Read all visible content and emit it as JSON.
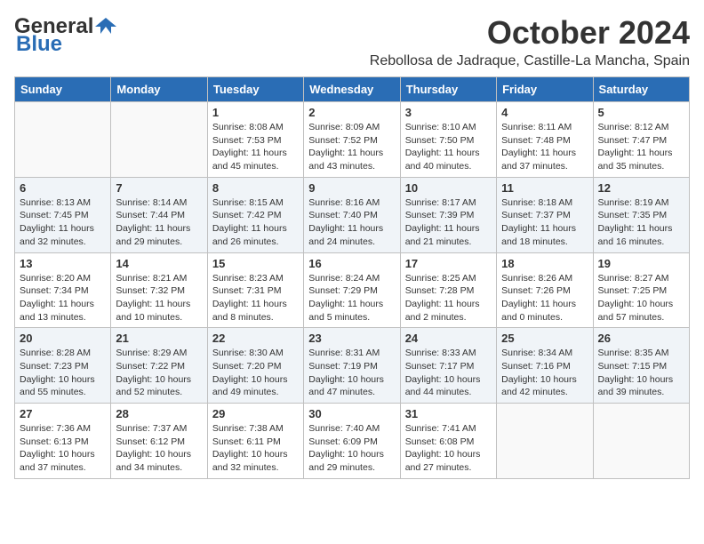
{
  "logo": {
    "line1": "General",
    "line2": "Blue"
  },
  "title": "October 2024",
  "subtitle": "Rebollosa de Jadraque, Castille-La Mancha, Spain",
  "weekdays": [
    "Sunday",
    "Monday",
    "Tuesday",
    "Wednesday",
    "Thursday",
    "Friday",
    "Saturday"
  ],
  "weeks": [
    {
      "shaded": false,
      "days": [
        {
          "date": "",
          "text": ""
        },
        {
          "date": "",
          "text": ""
        },
        {
          "date": "1",
          "text": "Sunrise: 8:08 AM\nSunset: 7:53 PM\nDaylight: 11 hours and 45 minutes."
        },
        {
          "date": "2",
          "text": "Sunrise: 8:09 AM\nSunset: 7:52 PM\nDaylight: 11 hours and 43 minutes."
        },
        {
          "date": "3",
          "text": "Sunrise: 8:10 AM\nSunset: 7:50 PM\nDaylight: 11 hours and 40 minutes."
        },
        {
          "date": "4",
          "text": "Sunrise: 8:11 AM\nSunset: 7:48 PM\nDaylight: 11 hours and 37 minutes."
        },
        {
          "date": "5",
          "text": "Sunrise: 8:12 AM\nSunset: 7:47 PM\nDaylight: 11 hours and 35 minutes."
        }
      ]
    },
    {
      "shaded": true,
      "days": [
        {
          "date": "6",
          "text": "Sunrise: 8:13 AM\nSunset: 7:45 PM\nDaylight: 11 hours and 32 minutes."
        },
        {
          "date": "7",
          "text": "Sunrise: 8:14 AM\nSunset: 7:44 PM\nDaylight: 11 hours and 29 minutes."
        },
        {
          "date": "8",
          "text": "Sunrise: 8:15 AM\nSunset: 7:42 PM\nDaylight: 11 hours and 26 minutes."
        },
        {
          "date": "9",
          "text": "Sunrise: 8:16 AM\nSunset: 7:40 PM\nDaylight: 11 hours and 24 minutes."
        },
        {
          "date": "10",
          "text": "Sunrise: 8:17 AM\nSunset: 7:39 PM\nDaylight: 11 hours and 21 minutes."
        },
        {
          "date": "11",
          "text": "Sunrise: 8:18 AM\nSunset: 7:37 PM\nDaylight: 11 hours and 18 minutes."
        },
        {
          "date": "12",
          "text": "Sunrise: 8:19 AM\nSunset: 7:35 PM\nDaylight: 11 hours and 16 minutes."
        }
      ]
    },
    {
      "shaded": false,
      "days": [
        {
          "date": "13",
          "text": "Sunrise: 8:20 AM\nSunset: 7:34 PM\nDaylight: 11 hours and 13 minutes."
        },
        {
          "date": "14",
          "text": "Sunrise: 8:21 AM\nSunset: 7:32 PM\nDaylight: 11 hours and 10 minutes."
        },
        {
          "date": "15",
          "text": "Sunrise: 8:23 AM\nSunset: 7:31 PM\nDaylight: 11 hours and 8 minutes."
        },
        {
          "date": "16",
          "text": "Sunrise: 8:24 AM\nSunset: 7:29 PM\nDaylight: 11 hours and 5 minutes."
        },
        {
          "date": "17",
          "text": "Sunrise: 8:25 AM\nSunset: 7:28 PM\nDaylight: 11 hours and 2 minutes."
        },
        {
          "date": "18",
          "text": "Sunrise: 8:26 AM\nSunset: 7:26 PM\nDaylight: 11 hours and 0 minutes."
        },
        {
          "date": "19",
          "text": "Sunrise: 8:27 AM\nSunset: 7:25 PM\nDaylight: 10 hours and 57 minutes."
        }
      ]
    },
    {
      "shaded": true,
      "days": [
        {
          "date": "20",
          "text": "Sunrise: 8:28 AM\nSunset: 7:23 PM\nDaylight: 10 hours and 55 minutes."
        },
        {
          "date": "21",
          "text": "Sunrise: 8:29 AM\nSunset: 7:22 PM\nDaylight: 10 hours and 52 minutes."
        },
        {
          "date": "22",
          "text": "Sunrise: 8:30 AM\nSunset: 7:20 PM\nDaylight: 10 hours and 49 minutes."
        },
        {
          "date": "23",
          "text": "Sunrise: 8:31 AM\nSunset: 7:19 PM\nDaylight: 10 hours and 47 minutes."
        },
        {
          "date": "24",
          "text": "Sunrise: 8:33 AM\nSunset: 7:17 PM\nDaylight: 10 hours and 44 minutes."
        },
        {
          "date": "25",
          "text": "Sunrise: 8:34 AM\nSunset: 7:16 PM\nDaylight: 10 hours and 42 minutes."
        },
        {
          "date": "26",
          "text": "Sunrise: 8:35 AM\nSunset: 7:15 PM\nDaylight: 10 hours and 39 minutes."
        }
      ]
    },
    {
      "shaded": false,
      "days": [
        {
          "date": "27",
          "text": "Sunrise: 7:36 AM\nSunset: 6:13 PM\nDaylight: 10 hours and 37 minutes."
        },
        {
          "date": "28",
          "text": "Sunrise: 7:37 AM\nSunset: 6:12 PM\nDaylight: 10 hours and 34 minutes."
        },
        {
          "date": "29",
          "text": "Sunrise: 7:38 AM\nSunset: 6:11 PM\nDaylight: 10 hours and 32 minutes."
        },
        {
          "date": "30",
          "text": "Sunrise: 7:40 AM\nSunset: 6:09 PM\nDaylight: 10 hours and 29 minutes."
        },
        {
          "date": "31",
          "text": "Sunrise: 7:41 AM\nSunset: 6:08 PM\nDaylight: 10 hours and 27 minutes."
        },
        {
          "date": "",
          "text": ""
        },
        {
          "date": "",
          "text": ""
        }
      ]
    }
  ]
}
